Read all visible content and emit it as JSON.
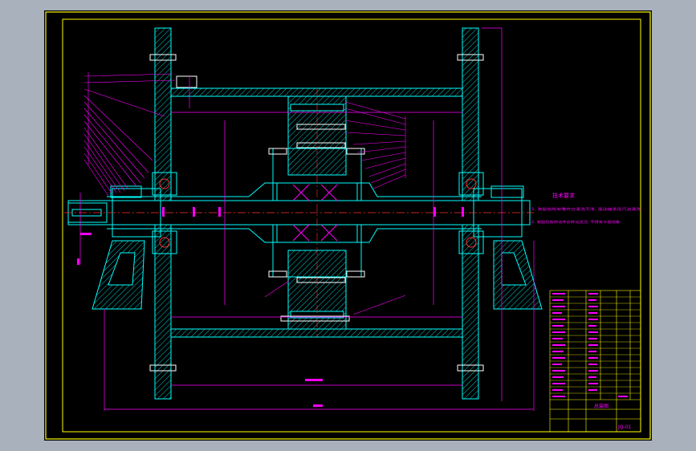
{
  "drawing": {
    "notes_title": "技术要求",
    "notes": [
      "1. 装配前所有零件应清洗干净, 滚动轴承用汽油清洗.",
      "2. 装配后各转动件应转动灵活, 不得有卡阻现象."
    ],
    "title_label": "总装图",
    "drawing_number": "JQ-01",
    "colors": {
      "background": "#000000",
      "frame": "#ffff00",
      "part": "#00ffff",
      "dimension": "#ff00ff",
      "centerline": "#ff3030",
      "hatch": "#00ffff",
      "window": "#a9b1bd"
    }
  }
}
